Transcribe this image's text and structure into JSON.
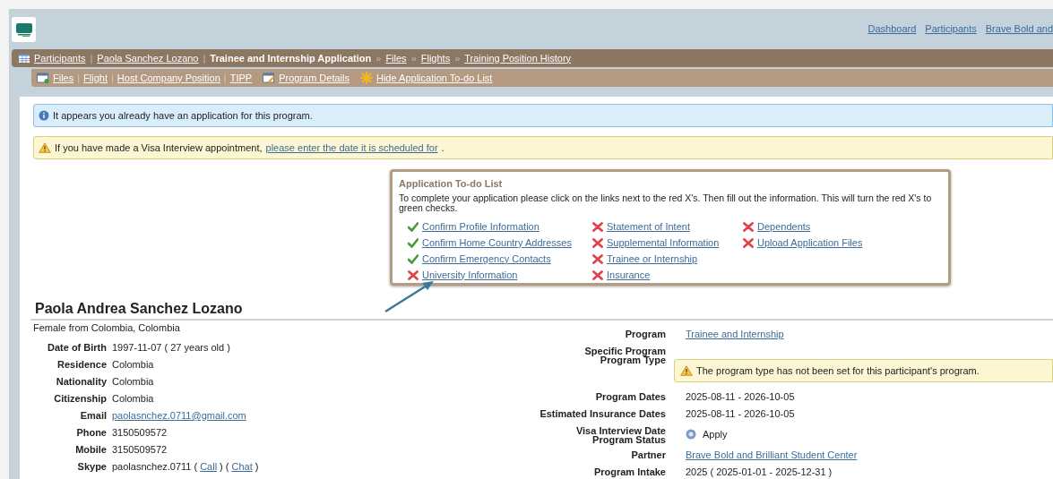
{
  "top_nav": [
    "Dashboard",
    "Participants",
    "Brave Bold and"
  ],
  "breadcrumb": [
    {
      "kind": "link",
      "text": "Participants"
    },
    {
      "kind": "link",
      "sep": "|",
      "text": "Paola Sanchez Lozano"
    },
    {
      "kind": "current",
      "sep": "|",
      "text": "Trainee and Internship Application"
    },
    {
      "kind": "link",
      "sep": "»",
      "text": "Files"
    },
    {
      "kind": "link",
      "sep": "»",
      "text": "Flights"
    },
    {
      "kind": "link",
      "sep": "»",
      "text": "Training Position History"
    }
  ],
  "sub_nav": [
    {
      "kind": "files",
      "separator": "|",
      "links": [
        "Files",
        "Flight",
        "Host Company Position",
        "TIPP"
      ]
    },
    {
      "kind": "details",
      "links": [
        "Program Details"
      ]
    },
    {
      "kind": "todo",
      "links": [
        "Hide Application To-do List"
      ]
    }
  ],
  "alerts": [
    {
      "kind": "info",
      "text": "It appears you already have an application for this program."
    },
    {
      "kind": "warning",
      "text": "If you have made a Visa Interview appointment,",
      "link": "please enter the date it is scheduled for",
      "after": "."
    }
  ],
  "todo": {
    "title": "Application To-do List",
    "intro": "To complete your application please click on the links next to the red X's. Then fill out the information. This will turn the red X's to green checks.",
    "columns": [
      [
        {
          "text": "Confirm Profile Information",
          "done": true
        },
        {
          "text": "Confirm Home Country Addresses",
          "done": true
        },
        {
          "text": "Confirm Emergency Contacts",
          "done": true
        },
        {
          "text": "University Information",
          "done": false
        }
      ],
      [
        {
          "text": "Statement of Intent",
          "done": false
        },
        {
          "text": "Supplemental Information",
          "done": false
        },
        {
          "text": "Trainee or Internship",
          "done": false
        },
        {
          "text": "Insurance",
          "done": false
        }
      ],
      [
        {
          "text": "Dependents",
          "done": false
        },
        {
          "text": "Upload Application Files",
          "done": false
        }
      ]
    ]
  },
  "participant": {
    "name": "Paola Andrea Sanchez Lozano",
    "summary": "Female from Colombia, Colombia",
    "details": [
      {
        "label": "Date of Birth",
        "kind": "text",
        "value": "1997-11-07 ( 27 years old )"
      },
      {
        "label": "Residence",
        "kind": "text",
        "value": "Colombia"
      },
      {
        "label": "Nationality",
        "kind": "text",
        "value": "Colombia"
      },
      {
        "label": "Citizenship",
        "kind": "text",
        "value": "Colombia"
      },
      {
        "label": "Email",
        "kind": "link",
        "value": "paolasnchez.0711@gmail.com"
      },
      {
        "label": "Phone",
        "kind": "text",
        "value": "3150509572"
      },
      {
        "label": "Mobile",
        "kind": "text",
        "value": "3150509572"
      },
      {
        "label": "Skype",
        "kind": "skype",
        "value": "paolasnchez.0711",
        "links": [
          {
            "open": "(",
            "text": "Call",
            "close": ")"
          },
          {
            "open": "(",
            "text": "Chat",
            "close": ")"
          }
        ]
      }
    ],
    "program": [
      {
        "labels": [
          "Program"
        ],
        "kind": "link",
        "value": "Trainee and Internship"
      },
      {
        "labels": [
          "Specific Program",
          "Program Type"
        ],
        "kind": "alert",
        "value": "The program type has not been set for this participant's program."
      },
      {
        "labels": [
          "Program Dates"
        ],
        "kind": "text",
        "value": "2025-08-11 - 2026-10-05"
      },
      {
        "labels": [
          "Estimated Insurance Dates"
        ],
        "kind": "text",
        "value": "2025-08-11 - 2026-10-05"
      },
      {
        "labels": [
          "Visa Interview Date",
          "Program Status"
        ],
        "kind": "status",
        "value": "Apply"
      },
      {
        "labels": [
          "Partner"
        ],
        "kind": "link",
        "value": "Brave Bold and Brilliant Student Center"
      },
      {
        "labels": [
          "Program Intake"
        ],
        "kind": "text",
        "value": "2025 ( 2025-01-01 - 2025-12-31 )"
      }
    ]
  }
}
